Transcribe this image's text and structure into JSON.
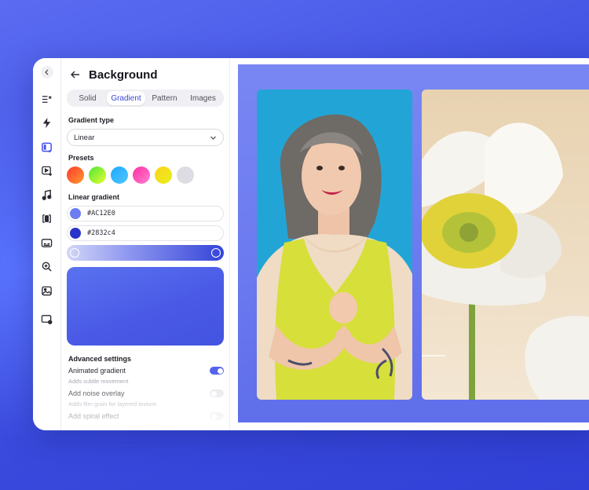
{
  "panel": {
    "title": "Background",
    "tabs": [
      {
        "label": "Solid"
      },
      {
        "label": "Gradient",
        "active": true
      },
      {
        "label": "Pattern"
      },
      {
        "label": "Images"
      }
    ],
    "gradient_type_label": "Gradient type",
    "gradient_type_value": "Linear",
    "presets_label": "Presets",
    "presets": [
      {
        "from": "#ff3a2e",
        "to": "#ff9a2e"
      },
      {
        "from": "#4ce43a",
        "to": "#e6ff2e"
      },
      {
        "from": "#1fa8ff",
        "to": "#4ec6ff"
      },
      {
        "from": "#ff2fa2",
        "to": "#ff7fd0"
      },
      {
        "from": "#ffd21c",
        "to": "#e6f01c"
      },
      {
        "from": "#dcdce2",
        "to": "#dcdce2"
      }
    ],
    "linear_gradient_label": "Linear gradient",
    "colors": [
      {
        "hex": "#AC12E0",
        "swatch": "#6b7df0"
      },
      {
        "hex": "#2832c4",
        "swatch": "#2a34c8"
      }
    ],
    "advanced_label": "Advanced settings",
    "options": [
      {
        "name": "Animated gradient",
        "desc": "Adds subtle movement",
        "on": true
      },
      {
        "name": "Add noise overlay",
        "desc": "Adds film grain for layered texture",
        "on": false
      },
      {
        "name": "Add spiral effect",
        "desc": "",
        "on": false
      }
    ]
  },
  "rail_icons": [
    "menu-close-icon",
    "bolt-icon",
    "layout-icon",
    "video-add-icon",
    "music-icon",
    "crop-icon",
    "subtitles-icon",
    "zoom-icon",
    "image-icon",
    "screen-record-icon"
  ],
  "colors": {
    "accent": "#4451e8",
    "stage": "#6a79ef"
  }
}
